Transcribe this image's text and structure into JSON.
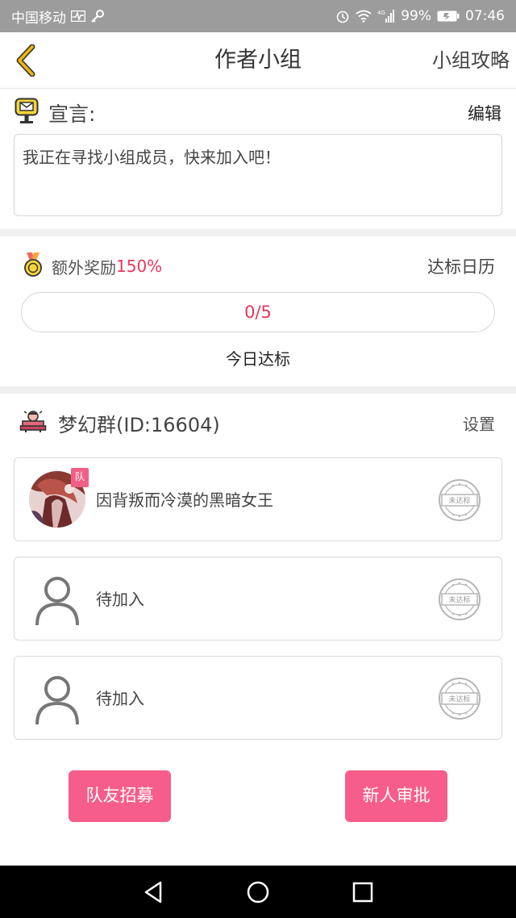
{
  "status_bar": {
    "carrier": "中国移动",
    "network": "4G",
    "battery": "99%",
    "time": "07:46"
  },
  "header": {
    "title": "作者小组",
    "right_link": "小组攻略"
  },
  "declaration": {
    "label": "宣言:",
    "edit": "编辑",
    "text": "我正在寻找小组成员，快来加入吧！"
  },
  "bonus": {
    "label": "额外奖励",
    "value": "150%",
    "calendar_link": "达标日历",
    "progress_text": "0/5",
    "progress_fraction": 0,
    "today_label": "今日达标"
  },
  "group": {
    "name": "梦幻群(ID:16604)",
    "settings": "设置",
    "members": [
      {
        "name": "因背叛而冷漠的黑暗女王",
        "badge": "队",
        "stamp": "未达标"
      },
      {
        "name": "待加入",
        "stamp": "未达标"
      },
      {
        "name": "待加入",
        "stamp": "未达标"
      }
    ]
  },
  "actions": {
    "recruit": "队友招募",
    "approve": "新人审批"
  },
  "colors": {
    "accent": "#f65d8a",
    "highlight": "#e8365d",
    "back_arrow": "#f2b705"
  }
}
